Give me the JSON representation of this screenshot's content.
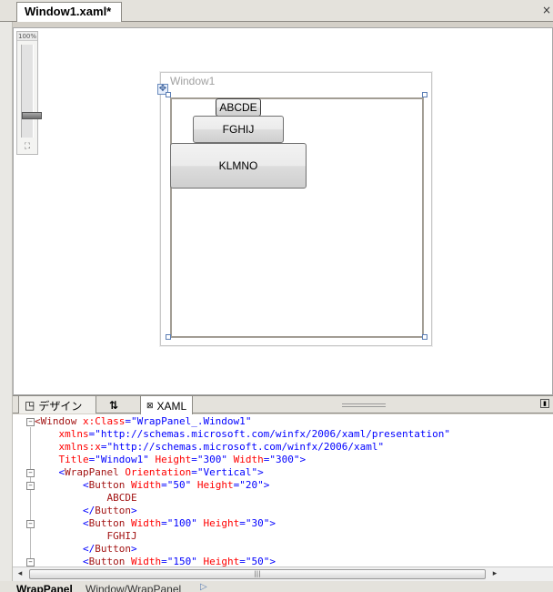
{
  "tab": {
    "title": "Window1.xaml*",
    "close_glyph": "×"
  },
  "zoom": {
    "label": "100%",
    "value_percent": 100,
    "fit_glyph": "⛶"
  },
  "preview": {
    "window_title": "Window1",
    "buttons": [
      {
        "label": "ABCDE",
        "width": 50,
        "height": 20
      },
      {
        "label": "FGHIJ",
        "width": 100,
        "height": 30
      },
      {
        "label": "KLMNO",
        "width": 150,
        "height": 50
      }
    ]
  },
  "view_tabs": {
    "design": "デザイン",
    "swap": "⇅",
    "xaml": "XAML"
  },
  "code_lines": [
    [
      [
        "tag",
        "<Window "
      ],
      [
        "attr",
        "x:Class"
      ],
      [
        "pun",
        "=\""
      ],
      [
        "val",
        "WrapPanel_.Window1"
      ],
      [
        "pun",
        "\""
      ]
    ],
    [
      [
        "attr",
        "    xmlns"
      ],
      [
        "pun",
        "=\""
      ],
      [
        "val",
        "http://schemas.microsoft.com/winfx/2006/xaml/presentation"
      ],
      [
        "pun",
        "\""
      ]
    ],
    [
      [
        "attr",
        "    xmlns:x"
      ],
      [
        "pun",
        "=\""
      ],
      [
        "val",
        "http://schemas.microsoft.com/winfx/2006/xaml"
      ],
      [
        "pun",
        "\""
      ]
    ],
    [
      [
        "attr",
        "    Title"
      ],
      [
        "pun",
        "=\""
      ],
      [
        "val",
        "Window1"
      ],
      [
        "pun",
        "\" "
      ],
      [
        "attr",
        "Height"
      ],
      [
        "pun",
        "=\""
      ],
      [
        "val",
        "300"
      ],
      [
        "pun",
        "\" "
      ],
      [
        "attr",
        "Width"
      ],
      [
        "pun",
        "=\""
      ],
      [
        "val",
        "300"
      ],
      [
        "pun",
        "\">"
      ]
    ],
    [
      [
        "pun",
        "    <"
      ],
      [
        "tag",
        "WrapPanel "
      ],
      [
        "attr",
        "Orientation"
      ],
      [
        "pun",
        "=\""
      ],
      [
        "val",
        "Vertical"
      ],
      [
        "pun",
        "\">"
      ]
    ],
    [
      [
        "pun",
        "        <"
      ],
      [
        "tag",
        "Button "
      ],
      [
        "attr",
        "Width"
      ],
      [
        "pun",
        "=\""
      ],
      [
        "val",
        "50"
      ],
      [
        "pun",
        "\" "
      ],
      [
        "attr",
        "Height"
      ],
      [
        "pun",
        "=\""
      ],
      [
        "val",
        "20"
      ],
      [
        "pun",
        "\">"
      ]
    ],
    [
      [
        "txt",
        "            ABCDE"
      ]
    ],
    [
      [
        "pun",
        "        </"
      ],
      [
        "tag",
        "Button"
      ],
      [
        "pun",
        ">"
      ]
    ],
    [
      [
        "pun",
        "        <"
      ],
      [
        "tag",
        "Button "
      ],
      [
        "attr",
        "Width"
      ],
      [
        "pun",
        "=\""
      ],
      [
        "val",
        "100"
      ],
      [
        "pun",
        "\" "
      ],
      [
        "attr",
        "Height"
      ],
      [
        "pun",
        "=\""
      ],
      [
        "val",
        "30"
      ],
      [
        "pun",
        "\">"
      ]
    ],
    [
      [
        "txt",
        "            FGHIJ"
      ]
    ],
    [
      [
        "pun",
        "        </"
      ],
      [
        "tag",
        "Button"
      ],
      [
        "pun",
        ">"
      ]
    ],
    [
      [
        "pun",
        "        <"
      ],
      [
        "tag",
        "Button "
      ],
      [
        "attr",
        "Width"
      ],
      [
        "pun",
        "=\""
      ],
      [
        "val",
        "150"
      ],
      [
        "pun",
        "\" "
      ],
      [
        "attr",
        "Height"
      ],
      [
        "pun",
        "=\""
      ],
      [
        "val",
        "50"
      ],
      [
        "pun",
        "\">"
      ]
    ]
  ],
  "scrollbar": {
    "left_glyph": "◂",
    "grip": "|||",
    "right_glyph": "▸"
  },
  "breadcrumb": {
    "active": "WrapPanel",
    "path": "Window/WrapPanel",
    "arrow": "▷"
  }
}
